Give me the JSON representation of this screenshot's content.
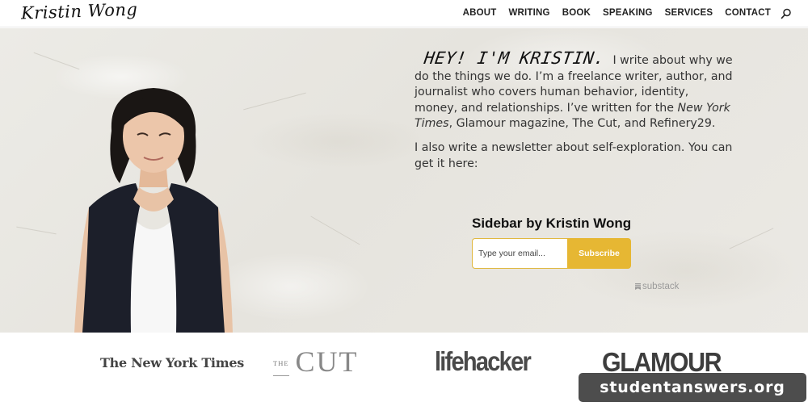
{
  "header": {
    "logo": "Kristin Wong",
    "nav": [
      "ABOUT",
      "WRITING",
      "BOOK",
      "SPEAKING",
      "SERVICES",
      "CONTACT"
    ],
    "search_icon": "search-icon"
  },
  "intro": {
    "greeting": "HEY! I'M KRISTIN.",
    "p1_a": "I write about why we do the things we do. I’m a freelance writer, author, and journalist who covers human behavior, identity, money, and relationships. I’ve written for the ",
    "p1_em": "New York Times",
    "p1_b": ", Glamour magazine, The Cut, and Refinery29.",
    "p2": "I also write a newsletter about self-exploration. You can get it here:"
  },
  "newsletter": {
    "title": "Sidebar by Kristin Wong",
    "email_placeholder": "Type your email...",
    "email_value": "",
    "subscribe_label": "Subscribe",
    "powered_by": "substack"
  },
  "press": {
    "nyt": "The New York Times",
    "cut_the": "THE",
    "cut_main": "CUT",
    "lifehacker": "lifehacker",
    "glamour": "GLAMOUR"
  },
  "watermark": "studentanswers.org",
  "colors": {
    "accent": "#e6b733",
    "wall": "#e9e7e2",
    "vest": "#1c1f2a",
    "hair": "#1a1614"
  }
}
